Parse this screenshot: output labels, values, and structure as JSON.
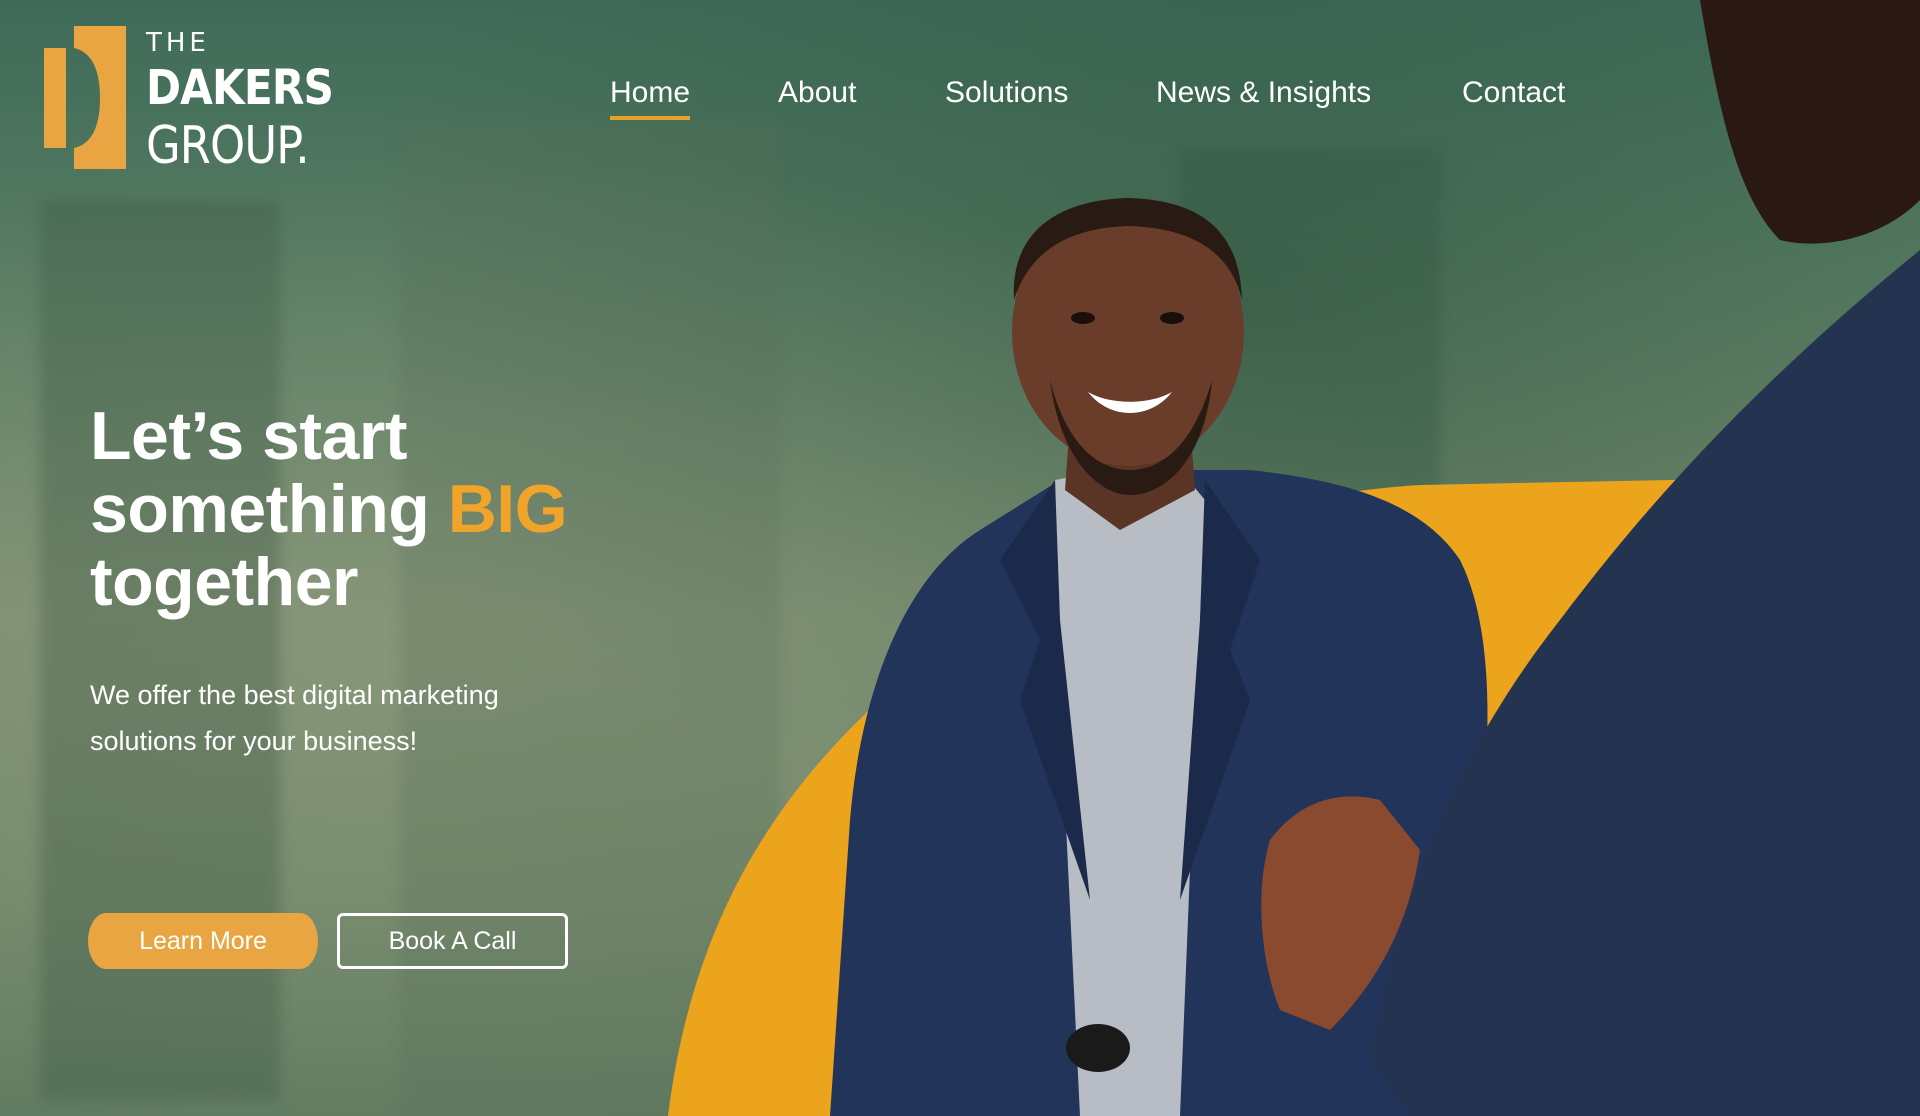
{
  "brand": {
    "the": "THE",
    "dakers": "DAKERS",
    "group": "GROUP.",
    "accent_color": "#e9a12a"
  },
  "nav": {
    "items": [
      {
        "label": "Home",
        "active": true
      },
      {
        "label": "About",
        "active": false
      },
      {
        "label": "Solutions",
        "active": false
      },
      {
        "label": "News & Insights",
        "active": false
      },
      {
        "label": "Contact",
        "active": false
      }
    ]
  },
  "hero": {
    "title_line1": "Let’s start",
    "title_line2_pre": "something ",
    "title_line2_accent": "BIG",
    "title_line3": "together",
    "subtitle": "We offer the best digital marketing solutions for your business!",
    "accent_color": "#f0a52a"
  },
  "buttons": {
    "learn_more": "Learn More",
    "book_call": "Book A Call"
  }
}
